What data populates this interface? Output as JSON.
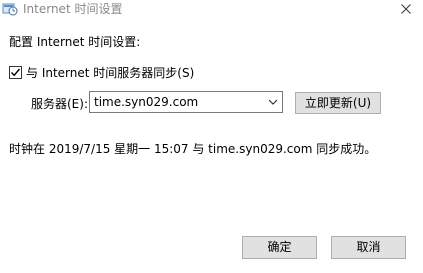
{
  "window": {
    "title": "Internet 时间设置",
    "close_symbol": "✕"
  },
  "dialog": {
    "heading": "配置 Internet 时间设置:",
    "sync_checkbox": {
      "label": "与 Internet 时间服务器同步(S)",
      "checked": true
    },
    "server": {
      "label": "服务器(E):",
      "value": "time.syn029.com"
    },
    "update_button_label": "立即更新(U)",
    "status_message": "时钟在 2019/7/15 星期一 15:07 与 time.syn029.com 同步成功。",
    "ok_label": "确定",
    "cancel_label": "取消"
  },
  "colors": {
    "title_text": "#888888",
    "button_face": "#e1e1e1",
    "button_border": "#adadad",
    "select_border": "#7a7a7a"
  }
}
